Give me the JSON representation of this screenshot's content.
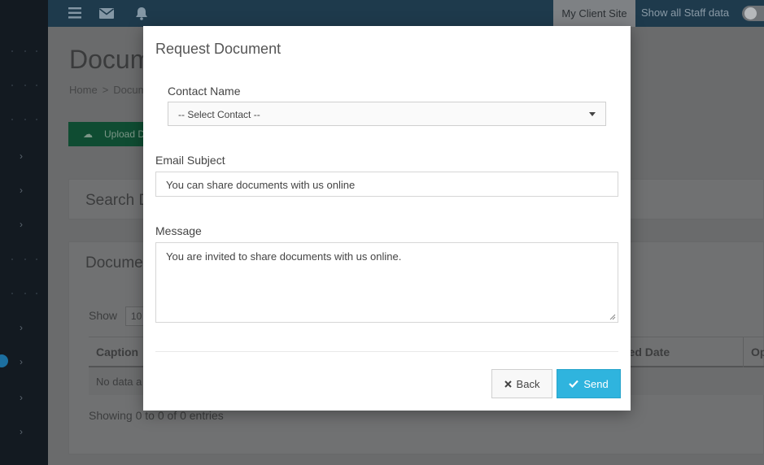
{
  "topbar": {
    "my_client_site": "My Client Site",
    "show_staff": "Show all Staff data"
  },
  "background": {
    "page_title": "Docum",
    "breadcrumb_home": "Home",
    "breadcrumb_sep": ">",
    "breadcrumb_current": "Docum",
    "upload_label": "Upload D",
    "search_panel_title": "Search D",
    "documents_panel_title": "Docume",
    "show_label": "Show",
    "page_length": "10",
    "columns": [
      "Caption",
      "ded Date",
      "Op"
    ],
    "empty_row": "No data a",
    "info": "Showing 0 to 0 of 0 entries"
  },
  "modal": {
    "title": "Request Document",
    "contact_label": "Contact Name",
    "contact_selected": "-- Select Contact --",
    "subject_label": "Email Subject",
    "subject_value": "You can share documents with us online",
    "message_label": "Message",
    "message_value": "You are invited to share documents with us online.",
    "back_label": "Back",
    "send_label": "Send"
  },
  "colors": {
    "accent": "#2fb4de",
    "sidebar": "#131a21",
    "topbar": "#1e3a4c"
  }
}
